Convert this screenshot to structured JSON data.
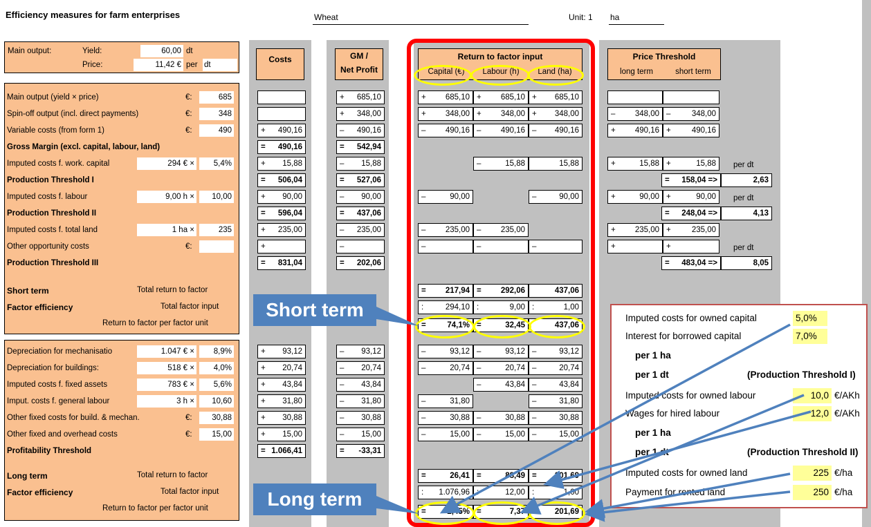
{
  "header": {
    "title": "Efficiency measures for farm enterprises",
    "crop": "Wheat",
    "unit_label": "Unit: 1",
    "unit_value": "ha"
  },
  "main_output": {
    "label": "Main output:",
    "yield_label": "Yield:",
    "yield_value": "60,00",
    "yield_unit": "dt",
    "price_label": "Price:",
    "price_value": "11,42 €",
    "per_label": "per",
    "price_unit": "dt"
  },
  "columns": {
    "costs": "Costs",
    "gm_line1": "GM /",
    "gm_line2": "Net Profit",
    "return_title": "Return to factor input",
    "capital": "Capital (€)",
    "labour": "Labour (h)",
    "land": "Land (ha)",
    "price_title": "Price Threshold",
    "long_term": "long term",
    "short_term": "short term"
  },
  "rows": [
    {
      "label": "Main output (yield × price)",
      "mid": "€:",
      "input": "685",
      "costs": "",
      "gm": "+ 685,10",
      "cap": "+ 685,10",
      "lab": "+ 685,10",
      "land": "+ 685,10",
      "ptl": "",
      "pts": ""
    },
    {
      "label": "Spin-off output (incl. direct payments)",
      "mid": "€:",
      "input": "348",
      "costs": "",
      "gm": "+ 348,00",
      "cap": "+ 348,00",
      "lab": "+ 348,00",
      "land": "+ 348,00",
      "ptl": "– 348,00",
      "pts": "– 348,00"
    },
    {
      "label": "Variable costs (from form 1)",
      "mid": "€:",
      "input": "490",
      "costs": "+ 490,16",
      "gm": "– 490,16",
      "cap": "– 490,16",
      "lab": "– 490,16",
      "land": "– 490,16",
      "ptl": "+ 490,16",
      "pts": "+ 490,16"
    },
    {
      "label": "Gross Margin (excl. capital, labour, land)",
      "bold": true,
      "costs": "= 490,16",
      "gm": "= 542,94"
    },
    {
      "label": "Imputed costs f. work. capital",
      "in1": "294 € ×",
      "input": "5,4%",
      "costs": "+ 15,88",
      "gm": "– 15,88",
      "lab": "– 15,88",
      "land": "15,88",
      "ptl": "+ 15,88",
      "pts": "+ 15,88",
      "note": "per dt"
    },
    {
      "label": "Production Threshold I",
      "bold": true,
      "costs": "= 506,04",
      "gm": "= 527,06",
      "pts": "= 158,04 =>",
      "ptv": "2,63"
    },
    {
      "label": "Imputed costs f. labour",
      "in1": "9,00 h ×",
      "input": "10,00",
      "costs": "+ 90,00",
      "gm": "– 90,00",
      "cap": "– 90,00",
      "land": "– 90,00",
      "ptl": "+ 90,00",
      "pts": "+ 90,00",
      "note": "per dt"
    },
    {
      "label": "Production Threshold II",
      "bold": true,
      "costs": "= 596,04",
      "gm": "= 437,06",
      "pts": "= 248,04 =>",
      "ptv": "4,13"
    },
    {
      "label": "Imputed costs f. total land",
      "in1": "1 ha ×",
      "input": "235",
      "costs": "+ 235,00",
      "gm": "– 235,00",
      "cap": "– 235,00",
      "lab": "– 235,00",
      "ptl": "+ 235,00",
      "pts": "+ 235,00"
    },
    {
      "label": "Other opportunity costs",
      "mid": "€:",
      "input": "",
      "costs": "+",
      "gm": "–",
      "cap": "–",
      "lab": "–",
      "land": "–",
      "ptl": "+",
      "pts": "+",
      "note": "per dt"
    },
    {
      "label": "Production Threshold III",
      "bold": true,
      "costs": "= 831,04",
      "gm": "= 202,06",
      "pts": "= 483,04 =>",
      "ptv": "8,05"
    }
  ],
  "short_term": {
    "label": "Short term",
    "total_return": "Total return to factor",
    "factor_eff": "Factor efficiency",
    "total_input": "Total factor input",
    "per_unit": "Return to factor per factor unit",
    "ret": [
      "= 217,94",
      "= 292,06",
      "437,06"
    ],
    "inp": [
      ": 294,10",
      ": 9,00",
      ": 1,00"
    ],
    "eff": [
      "= 74,1%",
      "= 32,45",
      "437,06"
    ]
  },
  "fixed_rows": [
    {
      "label": "Depreciation for mechanisatio",
      "in1": "1.047 € ×",
      "input": "8,9%",
      "costs": "+ 93,12",
      "gm": "– 93,12",
      "cap": "– 93,12",
      "lab": "– 93,12",
      "land": "– 93,12"
    },
    {
      "label": "Depreciation for buildings:",
      "in1": "518 € ×",
      "input": "4,0%",
      "costs": "+ 20,74",
      "gm": "– 20,74",
      "cap": "– 20,74",
      "lab": "– 20,74",
      "land": "– 20,74"
    },
    {
      "label": "Imputed costs f. fixed assets",
      "in1": "783 € ×",
      "input": "5,6%",
      "costs": "+ 43,84",
      "gm": "– 43,84",
      "lab": "– 43,84",
      "land": "– 43,84"
    },
    {
      "label": "Imput. costs f. general labour",
      "in1": "3 h ×",
      "input": "10,60",
      "costs": "+ 31,80",
      "gm": "– 31,80",
      "cap": "– 31,80",
      "land": "– 31,80"
    },
    {
      "label": "Other fixed costs for build. & mechan.",
      "mid": "€:",
      "input": "30,88",
      "costs": "+ 30,88",
      "gm": "– 30,88",
      "cap": "– 30,88",
      "lab": "– 30,88",
      "land": "– 30,88"
    },
    {
      "label": "Other fixed and overhead costs",
      "mid": "€:",
      "input": "15,00",
      "costs": "+ 15,00",
      "gm": "– 15,00",
      "cap": "– 15,00",
      "lab": "– 15,00",
      "land": "– 15,00"
    },
    {
      "label": "Profitability Threshold",
      "bold": true,
      "costs": "= 1.066,41",
      "gm": "= -33,31"
    }
  ],
  "long_term": {
    "label": "Long term",
    "total_return": "Total return to factor",
    "factor_eff": "Factor efficiency",
    "total_input": "Total factor input",
    "per_unit": "Return to factor per factor unit",
    "ret": [
      "= 26,41",
      "= 88,49",
      "= 201,69"
    ],
    "inp": [
      ": 1.076,96",
      ": 12,00",
      ": 1,00"
    ],
    "eff": [
      "= 2,45%",
      "= 7,37",
      "= 201,69"
    ]
  },
  "callouts": {
    "short": "Short term",
    "long": "Long term"
  },
  "info": {
    "owned_capital": "Imputed costs for owned capital",
    "owned_capital_val": "5,0%",
    "borrowed_capital": "Interest for borrowed capital",
    "borrowed_capital_val": "7,0%",
    "per_ha": "per 1 ha",
    "per_dt": "per 1 dt",
    "pt1": "(Production Threshold I)",
    "owned_labour": "Imputed costs for owned labour",
    "owned_labour_val": "10,0",
    "owned_labour_unit": "€/AKh",
    "hired_labour": "Wages for hired labour",
    "hired_labour_val": "12,0",
    "hired_labour_unit": "€/AKh",
    "per_ha2": "per 1 ha",
    "per_dt2": "per 1 dt",
    "pt2": "(Production Threshold II)",
    "owned_land": "Imputed costs for owned land",
    "owned_land_val": "225",
    "owned_land_unit": "€/ha",
    "rented_land": "Payment for rented land",
    "rented_land_val": "250",
    "rented_land_unit": "€/ha"
  }
}
